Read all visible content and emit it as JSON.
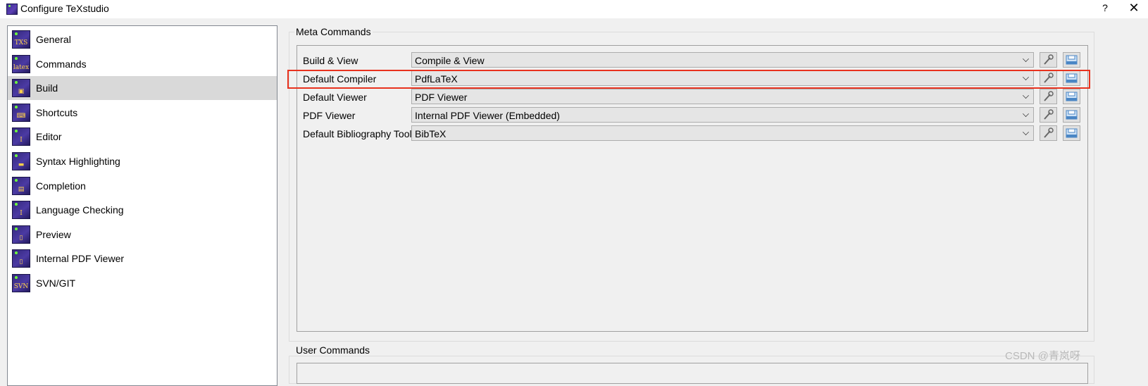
{
  "window": {
    "title": "Configure TeXstudio",
    "help_label": "?",
    "close_label": "✕"
  },
  "categories": [
    {
      "label": "General",
      "icon": "txs-icon",
      "glyph": "TXS"
    },
    {
      "label": "Commands",
      "icon": "latex-icon",
      "glyph": "latex"
    },
    {
      "label": "Build",
      "icon": "build-icon",
      "glyph": "▣"
    },
    {
      "label": "Shortcuts",
      "icon": "keyboard-icon",
      "glyph": "⌨"
    },
    {
      "label": "Editor",
      "icon": "text-cursor-icon",
      "glyph": "I"
    },
    {
      "label": "Syntax Highlighting",
      "icon": "highlight-icon",
      "glyph": "▬"
    },
    {
      "label": "Completion",
      "icon": "completion-icon",
      "glyph": "▤"
    },
    {
      "label": "Language Checking",
      "icon": "spellcheck-icon",
      "glyph": "I"
    },
    {
      "label": "Preview",
      "icon": "preview-icon",
      "glyph": "▯"
    },
    {
      "label": "Internal PDF Viewer",
      "icon": "pdf-viewer-icon",
      "glyph": "▯"
    },
    {
      "label": "SVN/GIT",
      "icon": "svn-icon",
      "glyph": "SVN"
    }
  ],
  "selected_category": "Build",
  "meta_commands": {
    "title": "Meta Commands",
    "rows": [
      {
        "label": "Build & View",
        "value": "Compile & View"
      },
      {
        "label": "Default Compiler",
        "value": "PdfLaTeX"
      },
      {
        "label": "Default Viewer",
        "value": "PDF Viewer"
      },
      {
        "label": "PDF Viewer",
        "value": "Internal PDF Viewer (Embedded)"
      },
      {
        "label": "Default Bibliography Tool",
        "value": "BibTeX"
      }
    ]
  },
  "user_commands": {
    "title": "User Commands"
  },
  "highlighted_row": "Default Compiler",
  "highlight_color": "#e8321e",
  "watermark": "CSDN @青岚呀"
}
